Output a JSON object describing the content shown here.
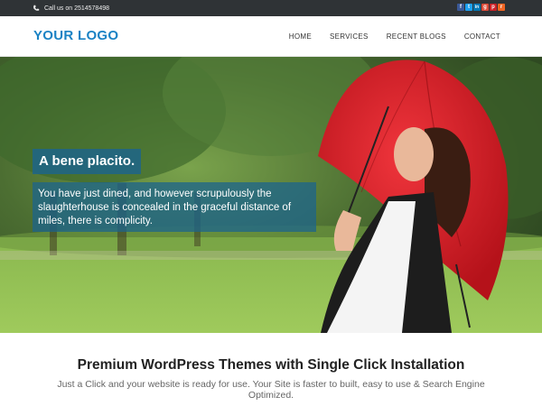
{
  "topbar": {
    "phone_text": "Call us on 2514578498",
    "social_icons": [
      {
        "name": "facebook-icon",
        "glyph": "f",
        "color": "#3b5998"
      },
      {
        "name": "twitter-icon",
        "glyph": "t",
        "color": "#1da1f2"
      },
      {
        "name": "linkedin-icon",
        "glyph": "in",
        "color": "#0077b5"
      },
      {
        "name": "google-plus-icon",
        "glyph": "g",
        "color": "#dd4b39"
      },
      {
        "name": "pinterest-icon",
        "glyph": "p",
        "color": "#cb2027"
      },
      {
        "name": "rss-icon",
        "glyph": "r",
        "color": "#f26522"
      }
    ]
  },
  "header": {
    "logo": "YOUR LOGO",
    "nav": [
      "HOME",
      "SERVICES",
      "RECENT BLOGS",
      "CONTACT"
    ]
  },
  "hero": {
    "title": "A bene placito.",
    "text": "You have just dined, and however scrupulously the slaughterhouse is concealed in the graceful distance of miles, there is complicity."
  },
  "content": {
    "heading": "Premium WordPress Themes with Single Click Installation",
    "subtext": "Just a Click and your website is ready for use. Your Site is faster to built, easy to use & Search Engine Optimized."
  },
  "colors": {
    "accent": "#1a82c4",
    "topbar_bg": "#2f3336",
    "caption_bg": "#1c648c",
    "umbrella": "#e0202a"
  }
}
